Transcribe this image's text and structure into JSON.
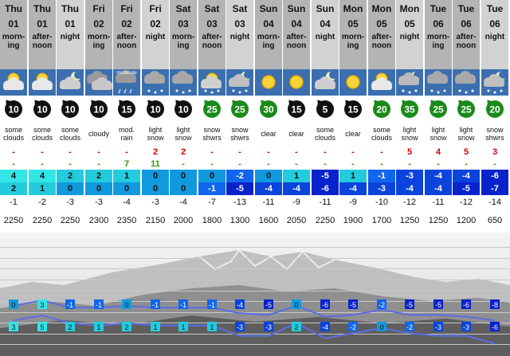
{
  "columns": [
    {
      "day": "Thu",
      "date": "01",
      "period": "morn-\ning",
      "icon": "some-clouds-icon",
      "wind": "10",
      "desc": "some\nclouds",
      "rain": "-",
      "snow": "-",
      "tmax": "4",
      "tmin": "2",
      "tlow": "-1",
      "frz": "2250"
    },
    {
      "day": "Thu",
      "date": "01",
      "period": "after-\nnoon",
      "icon": "some-clouds-icon",
      "wind": "10",
      "desc": "some\nclouds",
      "rain": "-",
      "snow": "-",
      "tmax": "4",
      "tmin": "1",
      "tlow": "-2",
      "frz": "2250"
    },
    {
      "day": "Thu",
      "date": "01",
      "period": "night",
      "icon": "some-clouds-night-icon",
      "wind": "10",
      "desc": "some\nclouds",
      "rain": "-",
      "snow": "-",
      "tmax": "2",
      "tmin": "0",
      "tlow": "-3",
      "frz": "2250"
    },
    {
      "day": "Fri",
      "date": "02",
      "period": "morn-\ning",
      "icon": "cloudy-icon",
      "wind": "10",
      "desc": "cloudy",
      "rain": "-",
      "snow": "-",
      "tmax": "2",
      "tmin": "0",
      "tlow": "-3",
      "frz": "2300"
    },
    {
      "day": "Fri",
      "date": "02",
      "period": "after-\nnoon",
      "icon": "moderate-rain-icon",
      "icon_text": "moderate",
      "wind": "15",
      "desc": "mod.\nrain",
      "rain": "-",
      "snow": "7",
      "tmax": "1",
      "tmin": "0",
      "tlow": "-4",
      "frz": "2350"
    },
    {
      "day": "Fri",
      "date": "02",
      "period": "night",
      "icon": "light-snow-icon",
      "wind": "10",
      "desc": "light\nsnow",
      "rain": "2",
      "snow": "11",
      "tmax": "0",
      "tmin": "0",
      "tlow": "-3",
      "frz": "2150"
    },
    {
      "day": "Sat",
      "date": "03",
      "period": "morn-\ning",
      "icon": "light-snow-icon",
      "wind": "10",
      "desc": "light\nsnow",
      "rain": "2",
      "snow": "-",
      "tmax": "0",
      "tmin": "0",
      "tlow": "-4",
      "frz": "2000"
    },
    {
      "day": "Sat",
      "date": "03",
      "period": "after-\nnoon",
      "icon": "snow-showers-icon",
      "wind": "25",
      "desc": "snow\nshwrs",
      "rain": "-",
      "snow": "-",
      "tmax": "0",
      "tmin": "-1",
      "tlow": "-7",
      "frz": "1800"
    },
    {
      "day": "Sat",
      "date": "03",
      "period": "night",
      "icon": "snow-showers-night-icon",
      "wind": "25",
      "desc": "snow\nshwrs",
      "rain": "-",
      "snow": "-",
      "tmax": "-2",
      "tmin": "-5",
      "tlow": "-13",
      "frz": "1300"
    },
    {
      "day": "Sun",
      "date": "04",
      "period": "morn-\ning",
      "icon": "clear-sun-icon",
      "wind": "30",
      "desc": "clear",
      "rain": "-",
      "snow": "-",
      "tmax": "0",
      "tmin": "-4",
      "tlow": "-11",
      "frz": "1600"
    },
    {
      "day": "Sun",
      "date": "04",
      "period": "after-\nnoon",
      "icon": "clear-sun-icon",
      "wind": "15",
      "desc": "clear",
      "rain": "-",
      "snow": "-",
      "tmax": "1",
      "tmin": "-4",
      "tlow": "-9",
      "frz": "2050"
    },
    {
      "day": "Sun",
      "date": "04",
      "period": "night",
      "icon": "some-clouds-night-icon",
      "wind": "5",
      "desc": "some\nclouds",
      "rain": "-",
      "snow": "-",
      "tmax": "-5",
      "tmin": "-6",
      "tlow": "-11",
      "frz": "2250"
    },
    {
      "day": "Mon",
      "date": "05",
      "period": "morn-\ning",
      "icon": "clear-sun-icon",
      "wind": "15",
      "desc": "clear",
      "rain": "-",
      "snow": "-",
      "tmax": "1",
      "tmin": "-4",
      "tlow": "-9",
      "frz": "1900"
    },
    {
      "day": "Mon",
      "date": "05",
      "period": "after-\nnoon",
      "icon": "some-clouds-icon",
      "wind": "20",
      "desc": "some\nclouds",
      "rain": "-",
      "snow": "-",
      "tmax": "-1",
      "tmin": "-3",
      "tlow": "-10",
      "frz": "1700"
    },
    {
      "day": "Mon",
      "date": "05",
      "period": "night",
      "icon": "light-snow-night-icon",
      "wind": "35",
      "desc": "light\nsnow",
      "rain": "5",
      "snow": "-",
      "tmax": "-3",
      "tmin": "-4",
      "tlow": "-12",
      "frz": "1250"
    },
    {
      "day": "Tue",
      "date": "06",
      "period": "morn-\ning",
      "icon": "light-snow-icon",
      "wind": "25",
      "desc": "light\nsnow",
      "rain": "4",
      "snow": "-",
      "tmax": "-4",
      "tmin": "-4",
      "tlow": "-11",
      "frz": "1250"
    },
    {
      "day": "Tue",
      "date": "06",
      "period": "after-\nnoon",
      "icon": "light-snow-icon",
      "wind": "25",
      "desc": "light\nsnow",
      "rain": "5",
      "snow": "-",
      "tmax": "-4",
      "tmin": "-5",
      "tlow": "-12",
      "frz": "1200"
    },
    {
      "day": "Tue",
      "date": "06",
      "period": "night",
      "icon": "snow-showers-night-icon",
      "wind": "20",
      "desc": "snow\nshwrs",
      "rain": "3",
      "snow": "-",
      "tmax": "-6",
      "tmin": "-7",
      "tlow": "-14",
      "frz": "650"
    }
  ],
  "chart": {
    "upper_line": [
      0,
      3,
      -1,
      -1,
      0,
      -1,
      -1,
      -1,
      -4,
      -5,
      0,
      -6,
      -5,
      -2,
      -5,
      -5,
      -6,
      -8
    ],
    "lower_line": [
      3,
      5,
      2,
      1,
      2,
      1,
      1,
      1,
      -3,
      -3,
      2,
      -4,
      -2,
      0,
      -2,
      -3,
      -3,
      -6
    ],
    "line_color": "#5a6de0"
  },
  "colors": {
    "header_dark": "#b4b4b4",
    "header_light": "#d2d2d2",
    "icon_bg": "#3b6fb0",
    "rain_text": "#cc0000",
    "snow_text": "#339900"
  }
}
